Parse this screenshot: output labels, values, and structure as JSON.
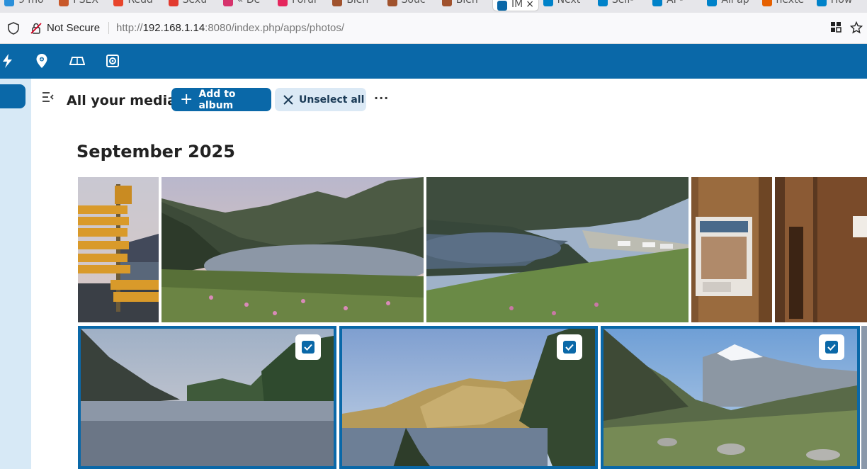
{
  "browser": {
    "tabs": [
      {
        "label": "9 mo",
        "color": "#2a8fd9"
      },
      {
        "label": "PSEX",
        "color": "#c8582a"
      },
      {
        "label": "Redd",
        "color": "#e8452c"
      },
      {
        "label": "Sexu",
        "color": "#e23a2f"
      },
      {
        "label": "« De",
        "color": "#d6336c"
      },
      {
        "label": "Forui",
        "color": "#e5265d"
      },
      {
        "label": "Bien",
        "color": "#a0522d"
      },
      {
        "label": "Souc",
        "color": "#a0522d"
      },
      {
        "label": "Bien",
        "color": "#a0522d"
      },
      {
        "label": "IM",
        "color": "#0a68a8",
        "active": true
      },
      {
        "label": "Next",
        "color": "#0082c9"
      },
      {
        "label": "Self-",
        "color": "#0082c9"
      },
      {
        "label": "AI -",
        "color": "#0082c9"
      },
      {
        "label": "All ap",
        "color": "#0082c9"
      },
      {
        "label": "nexte",
        "color": "#e66000"
      },
      {
        "label": "How",
        "color": "#0082c9"
      }
    ],
    "security_label": "Not Secure",
    "url_prefix": "http://",
    "url_host": "192.168.1.14",
    "url_rest": ":8080/index.php/apps/photos/"
  },
  "header": {
    "apps": [
      "activity-icon",
      "maps-icon",
      "cospend-icon",
      "photos-icon"
    ]
  },
  "toolbar": {
    "title": "All your media",
    "add_label": "Add to album",
    "unselect_label": "Unselect all",
    "more_label": "···"
  },
  "section": {
    "month_label": "September 2025"
  },
  "photos": {
    "row1": [
      "signpost",
      "lake-evening",
      "lake-road",
      "wood-poster",
      "wood-door"
    ],
    "row2": [
      {
        "name": "lake-dusk",
        "selected": true
      },
      {
        "name": "lake-sunlit-hill",
        "selected": true
      },
      {
        "name": "mont-blanc-valley",
        "selected": true
      }
    ]
  },
  "colors": {
    "accent": "#0a68a8",
    "sidebar_bg": "#d7e9f6",
    "secondary_button": "#dbe9f5"
  }
}
